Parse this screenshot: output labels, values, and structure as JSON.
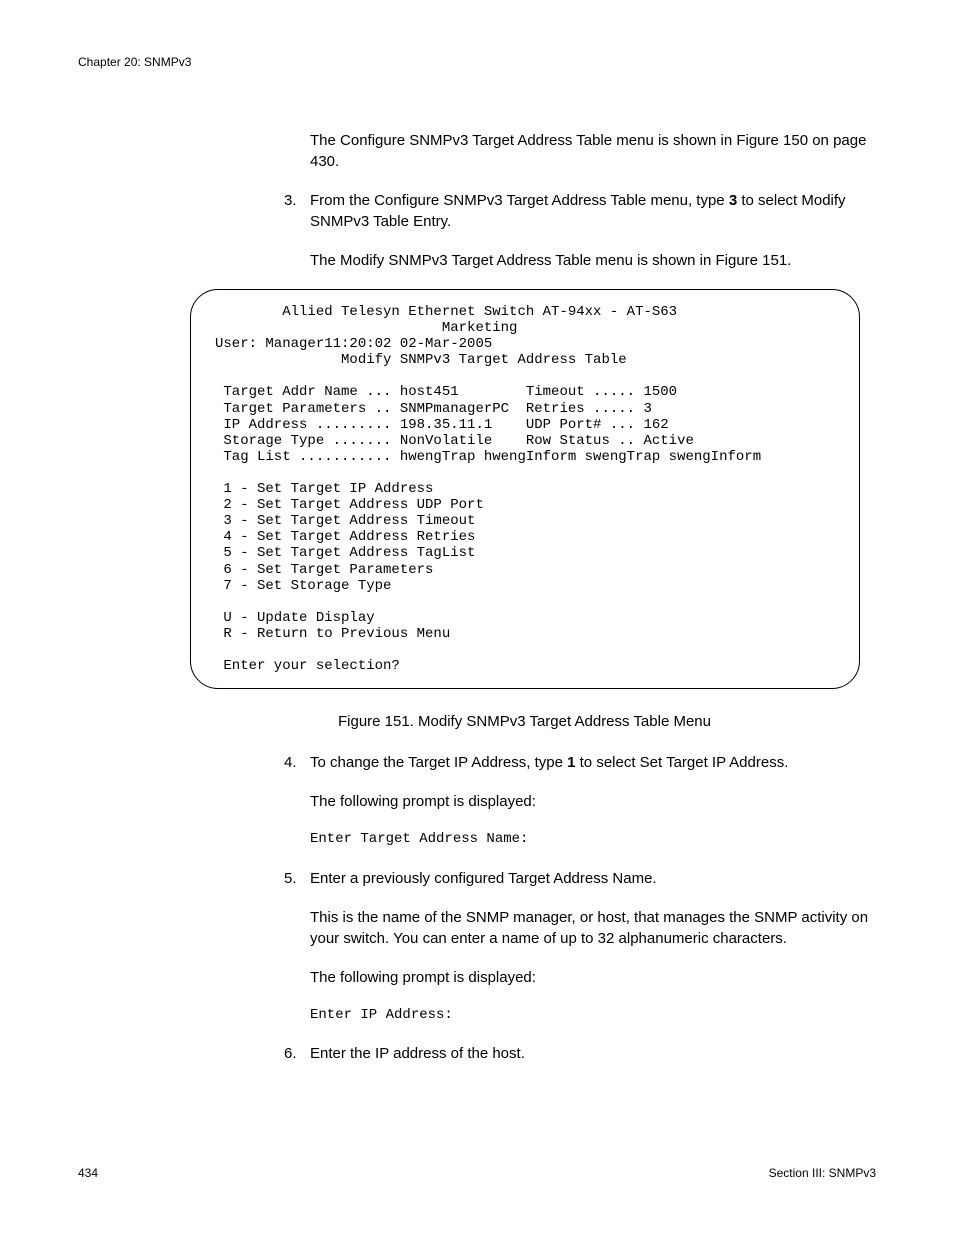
{
  "header": {
    "chapter": "Chapter 20: SNMPv3"
  },
  "intro_para": "The Configure SNMPv3 Target Address Table menu is shown in Figure 150 on page 430.",
  "steps": {
    "s3": {
      "num": "3.",
      "line1a": "From the Configure SNMPv3 Target Address Table menu, type ",
      "bold3": "3",
      "line1b": " to select Modify SNMPv3 Table Entry.",
      "line2": "The Modify SNMPv3 Target Address Table menu is shown in Figure 151."
    },
    "s4": {
      "num": "4.",
      "line1a": "To change the Target IP Address, type ",
      "bold1": "1",
      "line1b": " to select Set Target IP Address.",
      "line2": "The following prompt is displayed:",
      "prompt": "Enter Target Address Name:"
    },
    "s5": {
      "num": "5.",
      "line1": "Enter a previously configured Target Address Name.",
      "line2": "This is the name of the SNMP manager, or host, that manages the SNMP activity on your switch. You can enter a name of up to 32 alphanumeric characters.",
      "line3": "The following prompt is displayed:",
      "prompt": "Enter IP Address:"
    },
    "s6": {
      "num": "6.",
      "line1": "Enter the IP address of the host."
    }
  },
  "figure_caption": "Figure 151. Modify SNMPv3 Target Address Table Menu",
  "terminal": {
    "text": "        Allied Telesyn Ethernet Switch AT-94xx - AT-S63\n                           Marketing\nUser: Manager11:20:02 02-Mar-2005\n               Modify SNMPv3 Target Address Table\n\n Target Addr Name ... host451        Timeout ..... 1500\n Target Parameters .. SNMPmanagerPC  Retries ..... 3\n IP Address ......... 198.35.11.1    UDP Port# ... 162\n Storage Type ....... NonVolatile    Row Status .. Active\n Tag List ........... hwengTrap hwengInform swengTrap swengInform\n\n 1 - Set Target IP Address\n 2 - Set Target Address UDP Port\n 3 - Set Target Address Timeout\n 4 - Set Target Address Retries\n 5 - Set Target Address TagList\n 6 - Set Target Parameters\n 7 - Set Storage Type\n\n U - Update Display\n R - Return to Previous Menu\n\n Enter your selection?"
  },
  "footer": {
    "page_number": "434",
    "section": "Section III: SNMPv3"
  }
}
